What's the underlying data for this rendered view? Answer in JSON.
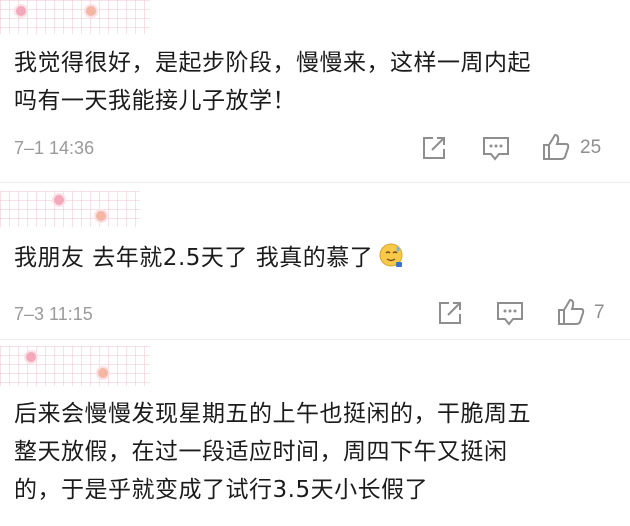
{
  "comments": [
    {
      "lines": [
        "我觉得很好，是起步阶段，慢慢来，这样一周内起",
        "吗有一天我能接儿子放学！"
      ],
      "timestamp": "7–1 14:36",
      "likes": "25"
    },
    {
      "lines": [
        "我朋友 去年就2.5天了 我真的慕了"
      ],
      "timestamp": "7–3 11:15",
      "likes": "7",
      "emoji": "sweat-smile-emoji"
    },
    {
      "lines": [
        "后来会慢慢发现星期五的上午也挺闲的，干脆周五",
        "整天放假，在过一段适应时间，周四下午又挺闲",
        "的，于是乎就变成了试行3.5天小长假了"
      ]
    }
  ],
  "icons": {
    "share": "share-icon",
    "comment": "comment-icon",
    "like": "thumbs-up-icon"
  },
  "colors": {
    "text": "#1b1b1b",
    "meta": "#9a9a9a",
    "icon": "#8e8e8e",
    "deco": "#f3a9b9"
  }
}
